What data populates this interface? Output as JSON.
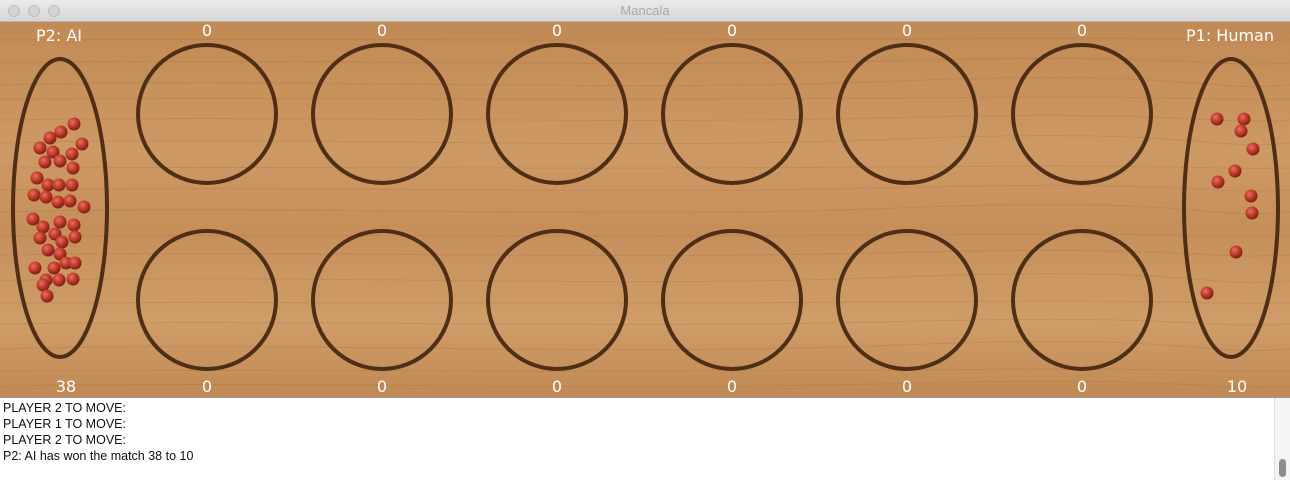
{
  "window": {
    "title": "Mancala"
  },
  "board": {
    "player2_label": "P2: AI",
    "player1_label": "P1: Human",
    "top_pits": [
      "0",
      "0",
      "0",
      "0",
      "0",
      "0"
    ],
    "bottom_pits": [
      "0",
      "0",
      "0",
      "0",
      "0",
      "0"
    ],
    "left_store": {
      "count": "38",
      "stones": 38
    },
    "right_store": {
      "count": "10",
      "stones": 10
    },
    "colors": {
      "wood": "#c8915a",
      "ring": "#4e2e14",
      "stone": "#c0392b",
      "label": "#ffffff"
    }
  },
  "log": {
    "lines": [
      "PLAYER 2 TO MOVE:",
      "PLAYER 1 TO MOVE:",
      "PLAYER 2 TO MOVE:",
      "P2: AI has won the match 38 to 10"
    ]
  }
}
